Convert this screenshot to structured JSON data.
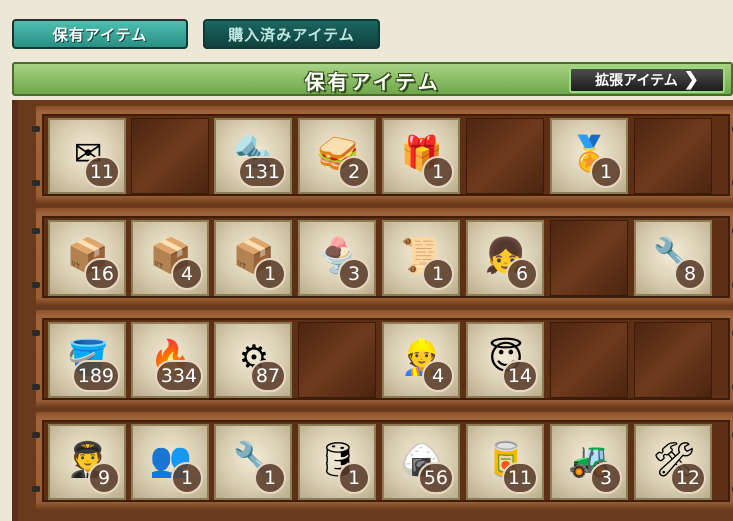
{
  "tabs": {
    "owned": "保有アイテム",
    "purchased": "購入済みアイテム"
  },
  "banner": {
    "title": "保有アイテム",
    "expand_label": "拡張アイテム",
    "expand_chevron": "❯"
  },
  "colors": {
    "tab_active": "#2a8f84",
    "banner_green": "#6ea84b",
    "shelf_wood": "#9a5e35"
  },
  "rows": [
    {
      "slots": [
        {
          "icon": "mail-and-ring-icon",
          "glyph": "✉",
          "count": "11"
        },
        null,
        {
          "icon": "screw-icon",
          "glyph": "🔩",
          "count": "131"
        },
        {
          "icon": "sandwich-icon",
          "glyph": "🥪",
          "count": "2"
        },
        {
          "icon": "gift-box-icon",
          "glyph": "🎁",
          "count": "1"
        },
        null,
        {
          "icon": "medal-icon",
          "glyph": "🏅",
          "count": "1"
        },
        null
      ]
    },
    {
      "slots": [
        {
          "icon": "furniture-box-small-icon",
          "glyph": "📦",
          "count": "16"
        },
        {
          "icon": "furniture-box-medium-icon",
          "glyph": "📦",
          "count": "4"
        },
        {
          "icon": "furniture-box-large-icon",
          "glyph": "📦",
          "count": "1"
        },
        {
          "icon": "parfait-icon",
          "glyph": "🍨",
          "count": "3"
        },
        {
          "icon": "blueprint-icon",
          "glyph": "📜",
          "count": "1"
        },
        {
          "icon": "fairy-headband-icon",
          "glyph": "👧",
          "count": "6"
        },
        null,
        {
          "icon": "repair-fairy-icon",
          "glyph": "🔧",
          "count": "8"
        }
      ]
    },
    {
      "slots": [
        {
          "icon": "bucket-icon",
          "glyph": "🪣",
          "count": "189"
        },
        {
          "icon": "burner-icon",
          "glyph": "🔥",
          "count": "334"
        },
        {
          "icon": "development-material-icon",
          "glyph": "⚙",
          "count": "87"
        },
        null,
        {
          "icon": "skilled-crew-icon",
          "glyph": "👷",
          "count": "4"
        },
        {
          "icon": "angel-fairy-icon",
          "glyph": "😇",
          "count": "14"
        },
        null,
        null
      ]
    },
    {
      "slots": [
        {
          "icon": "pilot-goggles-icon",
          "glyph": "🧑‍✈️",
          "count": "9"
        },
        {
          "icon": "paired-crew-icon",
          "glyph": "👥",
          "count": "1"
        },
        {
          "icon": "engine-part-icon",
          "glyph": "🔧",
          "count": "1"
        },
        {
          "icon": "drum-canister-icon",
          "glyph": "🛢",
          "count": "1"
        },
        {
          "icon": "rice-ball-icon",
          "glyph": "🍙",
          "count": "56"
        },
        {
          "icon": "supply-crate-icon",
          "glyph": "🥫",
          "count": "11"
        },
        {
          "icon": "bulldozer-icon",
          "glyph": "🚜",
          "count": "3"
        },
        {
          "icon": "tool-kit-icon",
          "glyph": "🛠",
          "count": "12"
        }
      ]
    }
  ]
}
